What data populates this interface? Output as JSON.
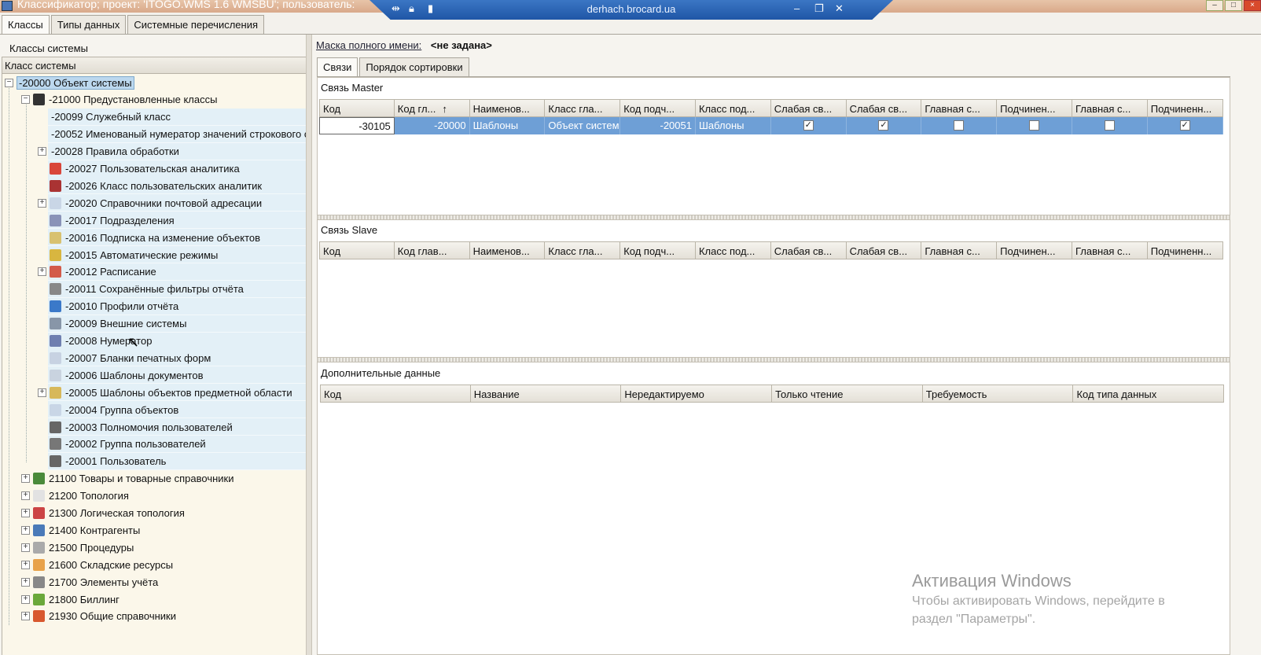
{
  "window": {
    "title": "Классификатор; проект: 'ITOGO.WMS 1.6 WMSBU'; пользователь:",
    "remote_host": "derhach.brocard.ua"
  },
  "main_tabs": [
    {
      "label": "Классы",
      "active": true
    },
    {
      "label": "Типы данных",
      "active": false
    },
    {
      "label": "Системные перечисления",
      "active": false
    }
  ],
  "left": {
    "caption": "Классы системы",
    "tree_header": "Класс системы",
    "nodes": [
      {
        "label": "-20000 Объект системы",
        "expander": "−",
        "selected": true
      },
      {
        "label": "-21000 Предустановленные классы",
        "expander": "−",
        "icon": "chess-rook-icon"
      },
      {
        "label": "-20099 Служебный класс"
      },
      {
        "label": "-20052 Именованый нумератор значений строкового ст"
      },
      {
        "label": "-20028 Правила обработки",
        "expander": "+"
      },
      {
        "label": "-20027 Пользовательская аналитика",
        "icon": "pencil-icon"
      },
      {
        "label": "-20026 Класс пользовательских аналитик",
        "icon": "book-icon"
      },
      {
        "label": "-20020 Справочники почтовой адресации",
        "expander": "+",
        "icon": "envelope-icon"
      },
      {
        "label": "-20017 Подразделения",
        "icon": "building-icon"
      },
      {
        "label": "-20016 Подписка на изменение объектов",
        "icon": "subscription-icon"
      },
      {
        "label": "-20015 Автоматические режимы",
        "icon": "wizard-icon"
      },
      {
        "label": "-20012 Расписание",
        "expander": "+",
        "icon": "calendar-icon"
      },
      {
        "label": "-20011 Сохранённые фильтры отчёта",
        "icon": "filter-icon"
      },
      {
        "label": "-20010 Профили отчёта",
        "icon": "report-profile-icon"
      },
      {
        "label": "-20009 Внешние системы",
        "icon": "server-icon"
      },
      {
        "label": "-20008 Нумератор",
        "icon": "numerator-icon"
      },
      {
        "label": "-20007 Бланки печатных форм",
        "icon": "form-icon"
      },
      {
        "label": "-20006 Шаблоны документов",
        "icon": "document-icon"
      },
      {
        "label": "-20005 Шаблоны объектов предметной области",
        "expander": "+",
        "icon": "template-icon"
      },
      {
        "label": "-20004 Группа объектов",
        "icon": "group-objects-icon"
      },
      {
        "label": "-20003 Полномочия пользователей",
        "icon": "user-permissions-icon"
      },
      {
        "label": "-20002 Группа пользователей",
        "icon": "user-group-icon"
      },
      {
        "label": "-20001 Пользователь",
        "icon": "user-icon"
      },
      {
        "label": "21100 Товары и товарные справочники",
        "expander": "+",
        "icon": "goods-icon"
      },
      {
        "label": "21200 Топология",
        "expander": "+",
        "icon": "topology-icon"
      },
      {
        "label": "21300 Логическая топология",
        "expander": "+",
        "icon": "tools-icon"
      },
      {
        "label": "21400 Контрагенты",
        "expander": "+",
        "icon": "partners-icon"
      },
      {
        "label": "21500 Процедуры",
        "expander": "+",
        "icon": "gears-icon"
      },
      {
        "label": "21600 Складские ресурсы",
        "expander": "+",
        "icon": "warehouse-icon"
      },
      {
        "label": "21700 Элементы учёта",
        "expander": "+",
        "icon": "calculator-icon"
      },
      {
        "label": "21800 Биллинг",
        "expander": "+",
        "icon": "billing-icon"
      },
      {
        "label": "21930 Общие справочники",
        "expander": "+",
        "icon": "box-icon"
      }
    ]
  },
  "right": {
    "mask_label": "Маска полного имени:",
    "mask_value": "<не задана>",
    "subtabs": [
      {
        "label": "Связи",
        "active": true
      },
      {
        "label": "Порядок сортировки",
        "active": false
      }
    ],
    "master": {
      "caption": "Связь Master",
      "columns": [
        "Код",
        "Код гл...",
        "Наименов...",
        "Класс гла...",
        "Код подч...",
        "Класс под...",
        "Слабая св...",
        "Слабая св...",
        "Главная с...",
        "Подчинен...",
        "Главная с...",
        "Подчиненн..."
      ],
      "sort_indicator": "↑",
      "row": {
        "code": "-30105",
        "main_code": "-20000",
        "name": "Шаблоны",
        "main_class": "Объект систем",
        "sub_code": "-20051",
        "sub_class": "Шаблоны",
        "checks": [
          true,
          true,
          false,
          false,
          false,
          true
        ]
      }
    },
    "slave": {
      "caption": "Связь Slave",
      "columns": [
        "Код",
        "Код глав...",
        "Наименов...",
        "Класс гла...",
        "Код подч...",
        "Класс под...",
        "Слабая св...",
        "Слабая св...",
        "Главная с...",
        "Подчинен...",
        "Главная с...",
        "Подчиненн..."
      ]
    },
    "extra": {
      "caption": "Дополнительные данные",
      "columns": [
        "Код",
        "Название",
        "Нередактируемо",
        "Только чтение",
        "Требуемость",
        "Код типа данных"
      ]
    }
  },
  "watermark": {
    "title": "Активация Windows",
    "line1": "Чтобы активировать Windows, перейдите в",
    "line2": "раздел \"Параметры\"."
  },
  "colors": {
    "selection": "#6e9fd6",
    "tree_row": "#e3f0f7",
    "titlebar": "#d9a98a",
    "remote_bar": "#2a63b3"
  }
}
